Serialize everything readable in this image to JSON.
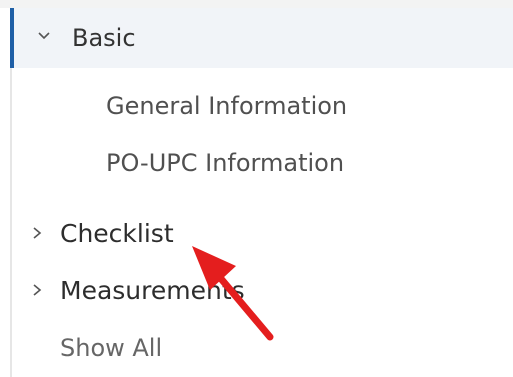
{
  "tree": {
    "basic": {
      "label": "Basic",
      "expanded": true,
      "chevron_icon": "chevron-down-icon",
      "children": [
        {
          "label": "General Information"
        },
        {
          "label": "PO-UPC Information"
        }
      ]
    },
    "checklist": {
      "label": "Checklist",
      "expanded": false,
      "chevron_icon": "chevron-right-icon"
    },
    "measurements": {
      "label": "Measurements",
      "expanded": false,
      "chevron_icon": "chevron-right-icon"
    },
    "show_all_label": "Show All"
  },
  "annotation": {
    "arrow_icon": "arrow-pointer-icon",
    "color": "#e41e1e"
  },
  "colors": {
    "accent": "#1f5fa6",
    "header_bg": "#f1f4f8"
  }
}
